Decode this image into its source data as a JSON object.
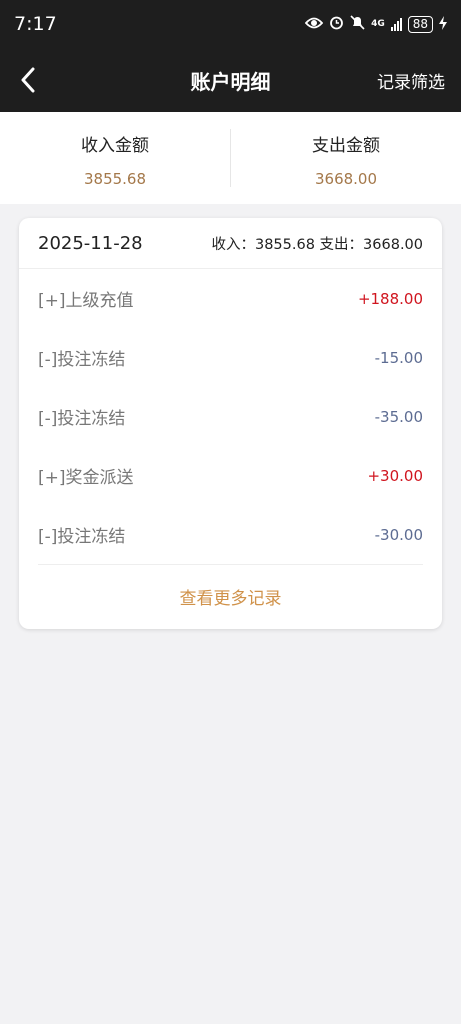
{
  "status": {
    "time": "7:17",
    "network": "4G",
    "battery": "88"
  },
  "nav": {
    "title": "账户明细",
    "filter_label": "记录筛选"
  },
  "summary": {
    "income_label": "收入金额",
    "income_value": "3855.68",
    "expense_label": "支出金额",
    "expense_value": "3668.00"
  },
  "card": {
    "date": "2025-11-28",
    "totals": "收入：3855.68 支出：3668.00",
    "rows": [
      {
        "label": "[+]上级充值",
        "amount": "+188.00"
      },
      {
        "label": "[-]投注冻结",
        "amount": "-15.00"
      },
      {
        "label": "[-]投注冻结",
        "amount": "-35.00"
      },
      {
        "label": "[+]奖金派送",
        "amount": "+30.00"
      },
      {
        "label": "[-]投注冻结",
        "amount": "-30.00"
      }
    ],
    "more_label": "查看更多记录"
  },
  "colors": {
    "header_bg": "#1e1e1e",
    "income_expense_value": "#a4784a",
    "positive_amount": "#d0151f",
    "negative_amount": "#5d6c92",
    "more_link": "#d0924a"
  }
}
